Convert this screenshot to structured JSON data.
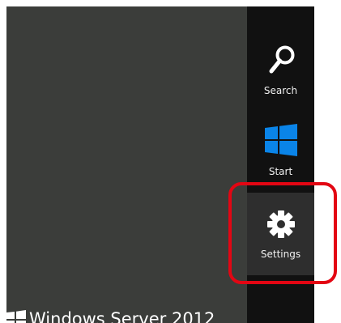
{
  "charms_bar": {
    "items": [
      {
        "label": "Search",
        "icon": "search-icon"
      },
      {
        "label": "Start",
        "icon": "windows-logo-icon"
      },
      {
        "label": "Settings",
        "icon": "gear-icon",
        "highlighted": true
      }
    ]
  },
  "branding": {
    "os_name": "Windows Server 2012"
  },
  "colors": {
    "desktop_background": "#3b3d3a",
    "charms_background": "#111111",
    "selected_charm_background": "#2e2e2e",
    "windows_logo_blue": "#0a84e8",
    "highlight_ring": "#e30613"
  }
}
